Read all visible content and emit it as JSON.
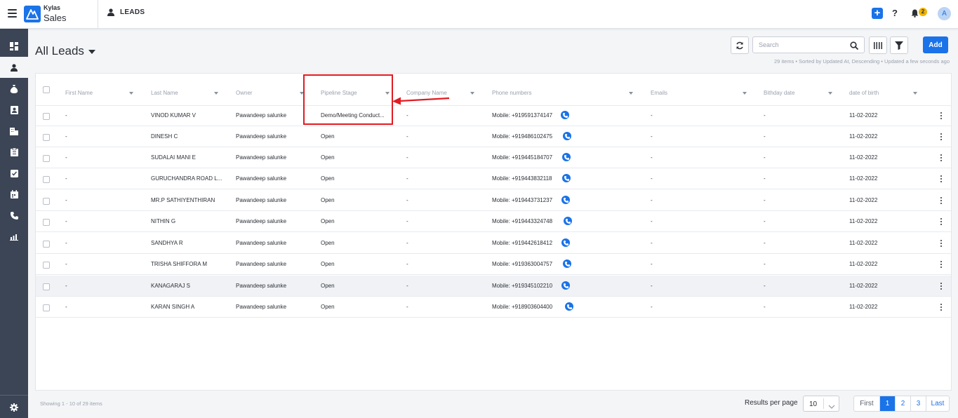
{
  "app": {
    "brand_top": "Kylas",
    "brand_main": "Sales",
    "module_title": "LEADS",
    "notification_count": "2",
    "avatar_initial": "A"
  },
  "header": {
    "view_title": "All Leads",
    "search_placeholder": "Search",
    "add_label": "Add",
    "sub_info": "29 items • Sorted by Updated At, Descending • Updated a few seconds ago"
  },
  "columns": [
    "First Name",
    "Last Name",
    "Owner",
    "Pipeline Stage",
    "Company Name",
    "Phone numbers",
    "Emails",
    "Bithday date",
    "date of birth"
  ],
  "rows": [
    {
      "first_name": "-",
      "last_name": "VINOD KUMAR V",
      "owner": "Pawandeep salunke",
      "pipeline_stage": "Demo/Meeting Conduct...",
      "company": "-",
      "phone": "Mobile: +919591374147",
      "email": "-",
      "birthday": "-",
      "dob": "11-02-2022"
    },
    {
      "first_name": "-",
      "last_name": "DINESH C",
      "owner": "Pawandeep salunke",
      "pipeline_stage": "Open",
      "company": "-",
      "phone": "Mobile: +919486102475",
      "email": "-",
      "birthday": "-",
      "dob": "11-02-2022"
    },
    {
      "first_name": "-",
      "last_name": "SUDALAI MANI E",
      "owner": "Pawandeep salunke",
      "pipeline_stage": "Open",
      "company": "-",
      "phone": "Mobile: +919445184707",
      "email": "-",
      "birthday": "-",
      "dob": "11-02-2022"
    },
    {
      "first_name": "-",
      "last_name": "GURUCHANDRA ROAD L...",
      "owner": "Pawandeep salunke",
      "pipeline_stage": "Open",
      "company": "-",
      "phone": "Mobile: +919443832118",
      "email": "-",
      "birthday": "-",
      "dob": "11-02-2022"
    },
    {
      "first_name": "-",
      "last_name": "MR.P SATHIYENTHIRAN",
      "owner": "Pawandeep salunke",
      "pipeline_stage": "Open",
      "company": "-",
      "phone": "Mobile: +919443731237",
      "email": "-",
      "birthday": "-",
      "dob": "11-02-2022"
    },
    {
      "first_name": "-",
      "last_name": "NITHIN G",
      "owner": "Pawandeep salunke",
      "pipeline_stage": "Open",
      "company": "-",
      "phone": "Mobile: +919443324748",
      "email": "-",
      "birthday": "-",
      "dob": "11-02-2022"
    },
    {
      "first_name": "-",
      "last_name": "SANDHYA R",
      "owner": "Pawandeep salunke",
      "pipeline_stage": "Open",
      "company": "-",
      "phone": "Mobile: +919442618412",
      "email": "-",
      "birthday": "-",
      "dob": "11-02-2022"
    },
    {
      "first_name": "-",
      "last_name": "TRISHA SHIFFORA M",
      "owner": "Pawandeep salunke",
      "pipeline_stage": "Open",
      "company": "-",
      "phone": "Mobile: +919363004757",
      "email": "-",
      "birthday": "-",
      "dob": "11-02-2022"
    },
    {
      "first_name": "-",
      "last_name": "KANAGARAJ S",
      "owner": "Pawandeep salunke",
      "pipeline_stage": "Open",
      "company": "-",
      "phone": "Mobile: +919345102210",
      "email": "-",
      "birthday": "-",
      "dob": "11-02-2022"
    },
    {
      "first_name": "-",
      "last_name": "KARAN SINGH A",
      "owner": "Pawandeep salunke",
      "pipeline_stage": "Open",
      "company": "-",
      "phone": "Mobile: +918903604400",
      "email": "-",
      "birthday": "-",
      "dob": "11-02-2022"
    }
  ],
  "footer": {
    "showing": "Showing 1 - 10 of 29 items",
    "results_per_page_label": "Results per page",
    "results_per_page_value": "10",
    "pager": {
      "first": "First",
      "pages": [
        "1",
        "2",
        "3"
      ],
      "last": "Last"
    }
  },
  "colors": {
    "primary": "#1a73e8",
    "sidebar": "#3c4556",
    "annotation": "#e11b22"
  }
}
